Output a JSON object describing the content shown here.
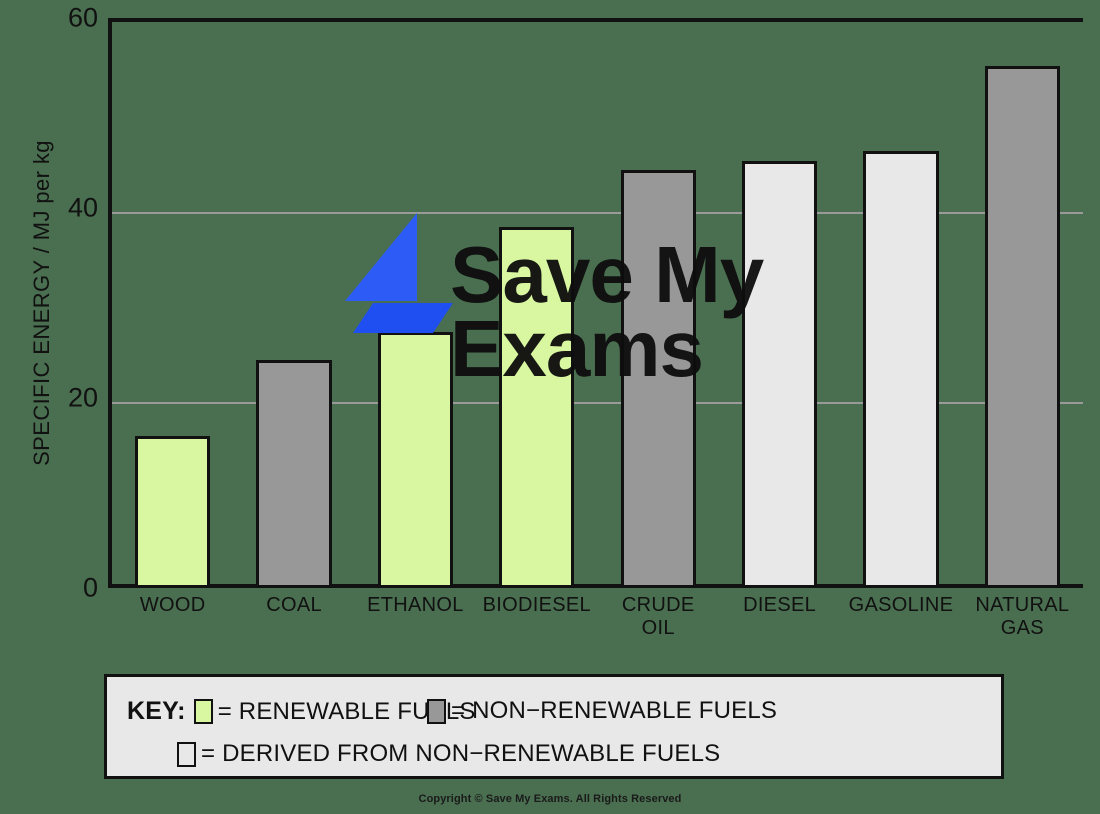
{
  "chart_data": {
    "type": "bar",
    "title": "",
    "xlabel": "",
    "ylabel": "SPECIFIC ENERGY / MJ per kg",
    "ylim": [
      0,
      60
    ],
    "yticks": [
      0,
      20,
      40,
      60
    ],
    "grid": "horizontal",
    "legend_position": "below-plot",
    "categories": [
      "WOOD",
      "COAL",
      "ETHANOL",
      "BIODIESEL",
      "CRUDE OIL",
      "DIESEL",
      "GASOLINE",
      "NATURAL GAS"
    ],
    "category_lines": [
      [
        "WOOD"
      ],
      [
        "COAL"
      ],
      [
        "ETHANOL"
      ],
      [
        "BIODIESEL"
      ],
      [
        "CRUDE",
        "OIL"
      ],
      [
        "DIESEL"
      ],
      [
        "GASOLINE"
      ],
      [
        "NATURAL",
        "GAS"
      ]
    ],
    "values": [
      16,
      24,
      27,
      38,
      44,
      45,
      46,
      55
    ],
    "bar_categories": [
      "renewable",
      "non-renewable",
      "renewable",
      "renewable",
      "non-renewable",
      "derived",
      "derived",
      "non-renewable"
    ],
    "colors": {
      "renewable": "#d9f7a0",
      "non-renewable": "#989898",
      "derived": "#e8e8e8",
      "bar_outline": "#111111",
      "axis": "#111111",
      "gridline": "#9a9a9a",
      "background": "#4a6f50",
      "legend_background": "#e8e8e8"
    }
  },
  "axis": {
    "y_title": "SPECIFIC ENERGY / MJ per kg",
    "y_tick_labels": [
      "60",
      "40",
      "20",
      "0"
    ]
  },
  "legend": {
    "key_label": "KEY:",
    "entries": [
      {
        "equals": "=",
        "label": "RENEWABLE  FUELS",
        "swatch": "renewable"
      },
      {
        "equals": "=",
        "label": "NON−RENEWABLE  FUELS",
        "swatch": "non-renewable"
      },
      {
        "equals": "=",
        "label": "DERIVED  FROM NON−RENEWABLE FUELS",
        "swatch": "derived"
      }
    ]
  },
  "watermark": {
    "line1": "Save My",
    "line2": "Exams",
    "logo": "lightning-bolt"
  },
  "footer": {
    "copyright": "Copyright © Save My Exams. All Rights Reserved"
  }
}
